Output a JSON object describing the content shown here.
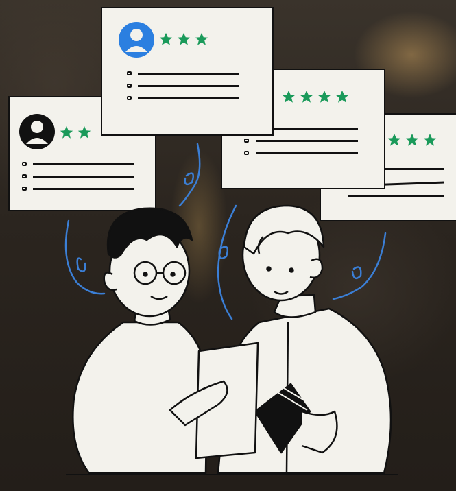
{
  "illustration": {
    "description_icon_names": [
      "user-avatar-icon",
      "star-icon",
      "review-card"
    ],
    "colors": {
      "star": "#1a9a5a",
      "avatar_blue": "#2b7fe0",
      "avatar_black": "#111111",
      "card_bg": "#f3f2ec",
      "squiggle": "#3b7fd6",
      "outline": "#111111"
    },
    "review_cards": [
      {
        "avatar": "black",
        "rating": 2
      },
      {
        "avatar": "blue",
        "rating": 3
      },
      {
        "avatar": "none",
        "rating": 4
      },
      {
        "avatar": "none",
        "rating": 3
      }
    ]
  }
}
